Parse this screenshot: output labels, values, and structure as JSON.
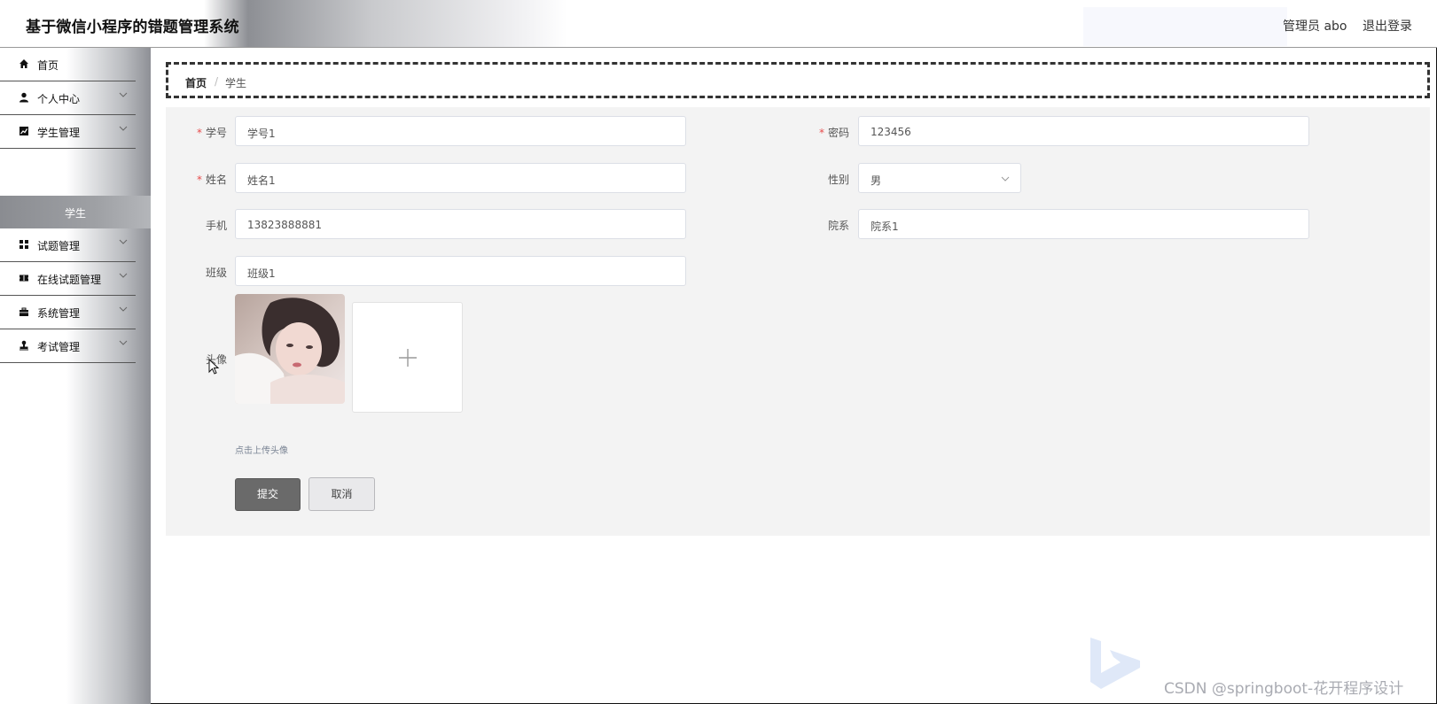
{
  "header": {
    "title": "基于微信小程序的错题管理系统",
    "user": "管理员 abo",
    "logout": "退出登录"
  },
  "sidebar": {
    "items": [
      {
        "label": "首页",
        "icon": "home-icon"
      },
      {
        "label": "个人中心",
        "icon": "user-icon"
      },
      {
        "label": "学生管理",
        "icon": "chart-icon"
      },
      {
        "label": "试题管理",
        "icon": "grid-icon"
      },
      {
        "label": "在线试题管理",
        "icon": "ticket-icon"
      },
      {
        "label": "系统管理",
        "icon": "briefcase-icon"
      },
      {
        "label": "考试管理",
        "icon": "stamp-icon"
      }
    ],
    "active_sub": "学生"
  },
  "breadcrumb": {
    "home": "首页",
    "separator": "/",
    "current": "学生"
  },
  "form": {
    "student_no": {
      "label": "学号",
      "value": "学号1",
      "required": true
    },
    "password": {
      "label": "密码",
      "value": "123456",
      "required": true
    },
    "name": {
      "label": "姓名",
      "value": "姓名1",
      "required": true
    },
    "gender": {
      "label": "性别",
      "value": "男"
    },
    "phone": {
      "label": "手机",
      "value": "13823888881"
    },
    "department": {
      "label": "院系",
      "value": "院系1"
    },
    "class": {
      "label": "班级",
      "value": "班级1"
    },
    "avatar": {
      "label": "头像",
      "hint": "点击上传头像"
    },
    "submit": "提交",
    "cancel": "取消"
  },
  "watermark": "CSDN @springboot-花开程序设计",
  "colors": {
    "required": "#e74c4c",
    "submit_bg": "#6a6a6a",
    "panel_bg": "#f3f3f3"
  }
}
